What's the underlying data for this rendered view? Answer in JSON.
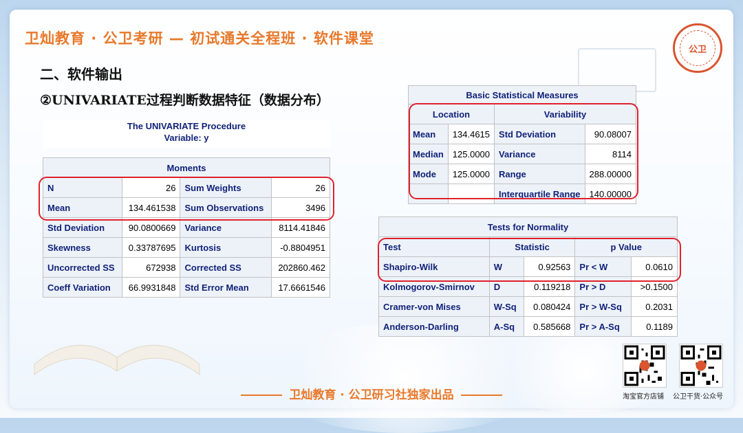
{
  "header": {
    "title": "卫灿教育 · 公卫考研 — 初试通关全程班 · 软件课堂"
  },
  "section": {
    "title": "二、软件输出",
    "subtitle": "②UNIVARIATE过程判断数据特征（数据分布）"
  },
  "logo": {
    "text": "公卫"
  },
  "proc": {
    "line1": "The UNIVARIATE Procedure",
    "line2": "Variable: y"
  },
  "moments": {
    "caption": "Moments",
    "rows": [
      [
        "N",
        "26",
        "Sum Weights",
        "26"
      ],
      [
        "Mean",
        "134.461538",
        "Sum Observations",
        "3496"
      ],
      [
        "Std Deviation",
        "90.0800669",
        "Variance",
        "8114.41846"
      ],
      [
        "Skewness",
        "0.33787695",
        "Kurtosis",
        "-0.8804951"
      ],
      [
        "Uncorrected SS",
        "672938",
        "Corrected SS",
        "202860.462"
      ],
      [
        "Coeff Variation",
        "66.9931848",
        "Std Error Mean",
        "17.6661546"
      ]
    ]
  },
  "basic": {
    "caption": "Basic Statistical Measures",
    "headers": [
      "Location",
      "Variability"
    ],
    "rows": [
      [
        "Mean",
        "134.4615",
        "Std Deviation",
        "90.08007"
      ],
      [
        "Median",
        "125.0000",
        "Variance",
        "8114"
      ],
      [
        "Mode",
        "125.0000",
        "Range",
        "288.00000"
      ],
      [
        "",
        "",
        "Interquartile Range",
        "140.00000"
      ]
    ]
  },
  "normality": {
    "caption": "Tests for Normality",
    "headers": [
      "Test",
      "Statistic",
      "p Value"
    ],
    "rows": [
      [
        "Shapiro-Wilk",
        "W",
        "0.92563",
        "Pr < W",
        "0.0610"
      ],
      [
        "Kolmogorov-Smirnov",
        "D",
        "0.119218",
        "Pr > D",
        ">0.1500"
      ],
      [
        "Cramer-von Mises",
        "W-Sq",
        "0.080424",
        "Pr > W-Sq",
        "0.2031"
      ],
      [
        "Anderson-Darling",
        "A-Sq",
        "0.585668",
        "Pr > A-Sq",
        "0.1189"
      ]
    ]
  },
  "footer": {
    "text": "卫灿教育 · 公卫研习社独家出品"
  },
  "qr": [
    {
      "label": "淘宝官方店铺",
      "icon": "qr-code-icon"
    },
    {
      "label": "公卫干货·公众号",
      "icon": "qr-code-icon"
    }
  ],
  "colors": {
    "accent": "#e8782a",
    "highlight": "#e0202c",
    "sas_header": "#112277"
  }
}
